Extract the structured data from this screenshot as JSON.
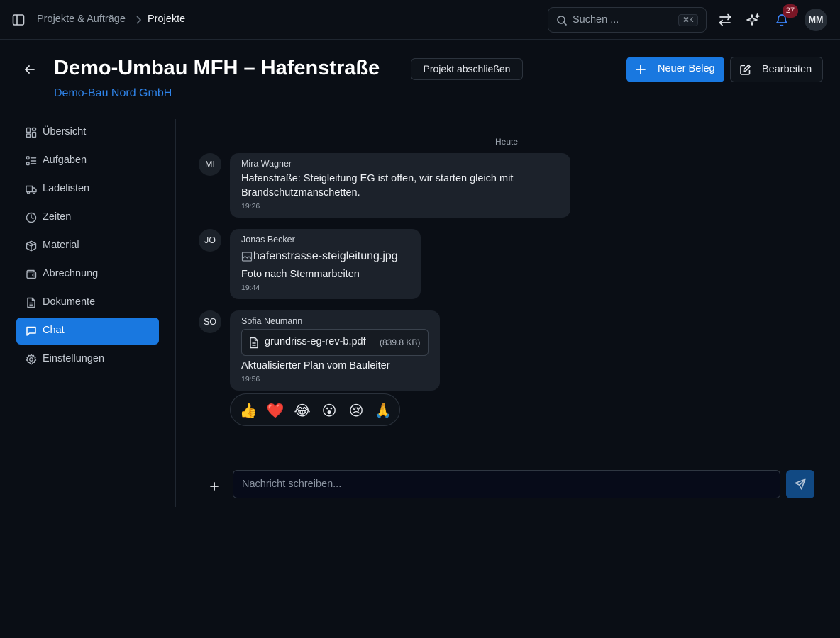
{
  "topbar": {
    "breadcrumb": [
      "Projekte & Aufträge",
      "Projekte"
    ],
    "search": {
      "placeholder": "Suchen ...",
      "shortcut": "⌘K"
    },
    "notifications_count": "27",
    "user_initials": "MM"
  },
  "header": {
    "title": "Demo-Umbau MFH – Hafenstraße",
    "complete_button": "Projekt abschließen",
    "client": "Demo-Bau Nord GmbH",
    "new_doc_button": "Neuer Beleg",
    "edit_button": "Bearbeiten"
  },
  "sidebar": {
    "items": [
      {
        "label": "Übersicht",
        "icon": "dashboard-icon",
        "active": false
      },
      {
        "label": "Aufgaben",
        "icon": "list-checks-icon",
        "active": false
      },
      {
        "label": "Ladelisten",
        "icon": "truck-icon",
        "active": false
      },
      {
        "label": "Zeiten",
        "icon": "clock-icon",
        "active": false
      },
      {
        "label": "Material",
        "icon": "package-icon",
        "active": false
      },
      {
        "label": "Abrechnung",
        "icon": "wallet-icon",
        "active": false
      },
      {
        "label": "Dokumente",
        "icon": "file-text-icon",
        "active": false
      },
      {
        "label": "Chat",
        "icon": "message-square-icon",
        "active": true
      },
      {
        "label": "Einstellungen",
        "icon": "gear-icon",
        "active": false
      }
    ]
  },
  "chat": {
    "day_label": "Heute",
    "messages": [
      {
        "initials": "MI",
        "author": "Mira Wagner",
        "text_lines": [
          "Hafenstraße: Steigleitung EG ist offen, wir starten gleich mit",
          "Brandschutzmanschetten."
        ],
        "time": "19:26"
      },
      {
        "initials": "JO",
        "author": "Jonas Becker",
        "image_alt": "hafenstrasse-steigleitung.jpg",
        "text": "Foto nach Stemmarbeiten",
        "time": "19:44"
      },
      {
        "initials": "SO",
        "author": "Sofia Neumann",
        "file": {
          "name": "grundriss-eg-rev-b.pdf",
          "size": "(839.8 KB)"
        },
        "text": "Aktualisierter Plan vom Bauleiter",
        "time": "19:56"
      }
    ],
    "reactions": [
      "👍",
      "❤️",
      "😂",
      "😮",
      "😢",
      "🙏"
    ]
  },
  "composer": {
    "placeholder": "Nachricht schreiben..."
  },
  "colors": {
    "accent": "#1978e0",
    "link": "#2f84ea",
    "background": "#0a0e15",
    "bubble": "#1c222b",
    "badge": "#7a1626"
  }
}
